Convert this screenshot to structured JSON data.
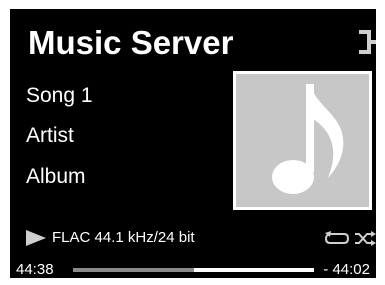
{
  "header": {
    "title": "Music Server",
    "source_icon": "input-source-icon"
  },
  "track": {
    "song": "Song 1",
    "artist": "Artist",
    "album": "Album",
    "album_art_icon": "music-note-icon"
  },
  "playback": {
    "state_icon": "play-icon",
    "format": "FLAC 44.1 kHz/24 bit",
    "repeat_icon": "repeat-icon",
    "shuffle_icon": "shuffle-icon",
    "elapsed": "44:38",
    "remaining": "- 44:02",
    "progress_fraction": 0.5
  },
  "colors": {
    "background": "#000000",
    "text": "#ffffff",
    "album_art_bg": "#c7c7c7",
    "progress_played": "#8a8a8a",
    "progress_remaining": "#ffffff",
    "icon_gray": "#cfcfcf"
  }
}
